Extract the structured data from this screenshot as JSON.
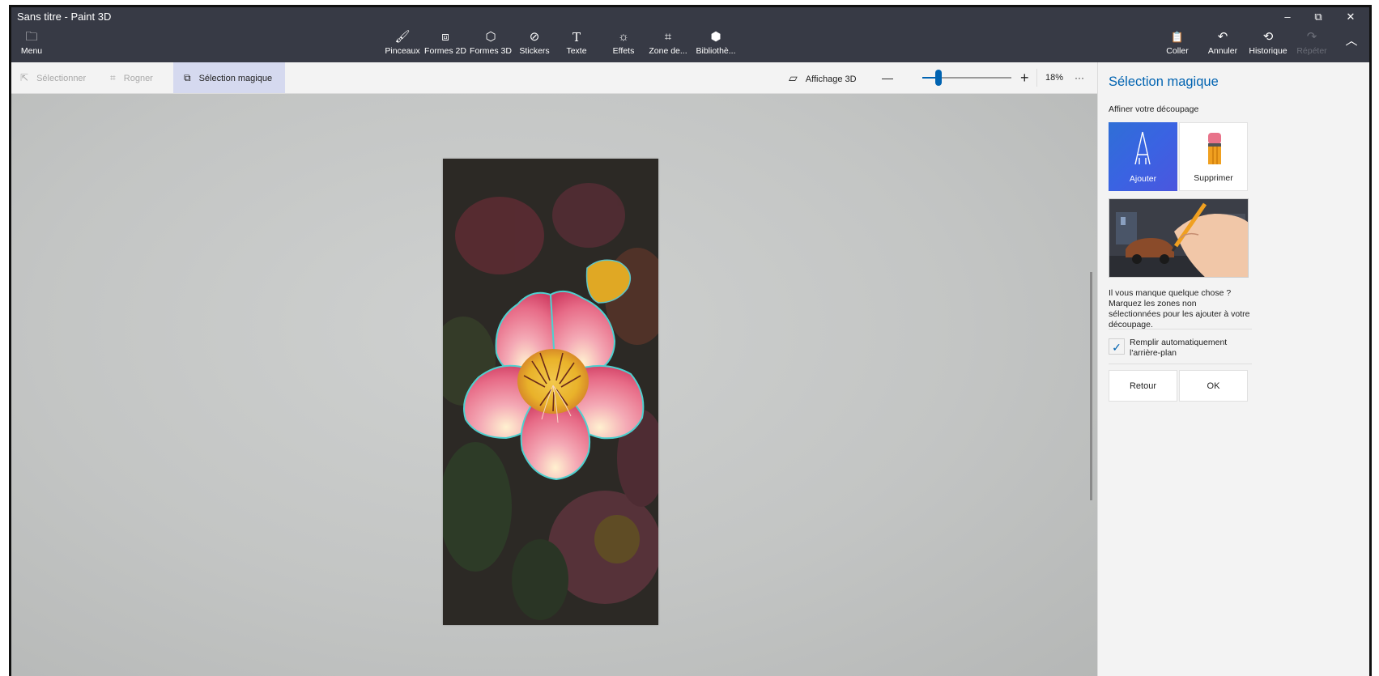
{
  "window": {
    "title": "Sans titre - Paint 3D",
    "minimize": "–",
    "restore": "⧉",
    "close": "✕"
  },
  "ribbon": {
    "menu": {
      "icon": "folder-icon",
      "glyph": "🗀",
      "label": "Menu"
    },
    "tools": [
      {
        "key": "pinceaux",
        "icon": "brush-icon",
        "glyph": "🖌",
        "label": "Pinceaux"
      },
      {
        "key": "formes2d",
        "icon": "shapes-2d-icon",
        "glyph": "⧈",
        "label": "Formes 2D"
      },
      {
        "key": "formes3d",
        "icon": "cube-icon",
        "glyph": "⬡",
        "label": "Formes 3D"
      },
      {
        "key": "stickers",
        "icon": "sticker-icon",
        "glyph": "⊘",
        "label": "Stickers"
      },
      {
        "key": "texte",
        "icon": "text-icon",
        "glyph": "T",
        "label": "Texte"
      },
      {
        "key": "effets",
        "icon": "sun-icon",
        "glyph": "☼",
        "label": "Effets"
      },
      {
        "key": "zone",
        "icon": "canvas-icon",
        "glyph": "⌗",
        "label": "Zone de..."
      },
      {
        "key": "biblio",
        "icon": "library-icon",
        "glyph": "⬢",
        "label": "Bibliothè..."
      }
    ],
    "right": [
      {
        "key": "coller",
        "icon": "paste-icon",
        "glyph": "📋",
        "label": "Coller",
        "enabled": true
      },
      {
        "key": "annuler",
        "icon": "undo-icon",
        "glyph": "↶",
        "label": "Annuler",
        "enabled": true
      },
      {
        "key": "historique",
        "icon": "history-icon",
        "glyph": "⟲",
        "label": "Historique",
        "enabled": true
      },
      {
        "key": "repeter",
        "icon": "redo-icon",
        "glyph": "↷",
        "label": "Répéter",
        "enabled": false
      }
    ],
    "collapse_glyph": "︿"
  },
  "subbar": {
    "select": "Sélectionner",
    "crop": "Rogner",
    "magic": "Sélection magique",
    "view3d": "Affichage 3D",
    "zoom_minus": "—",
    "zoom_plus": "+",
    "zoom_level": 18,
    "zoom_text": "18%",
    "more": "···"
  },
  "panel": {
    "title": "Sélection magique",
    "subtitle": "Affiner votre découpage",
    "add_label": "Ajouter",
    "delete_label": "Supprimer",
    "help_text": "Il vous manque quelque chose ? Marquez les zones non sélectionnées pour les ajouter à votre découpage.",
    "autofill_checked": true,
    "autofill_label": "Remplir automatiquement l'arrière-plan",
    "back_label": "Retour",
    "ok_label": "OK"
  },
  "colors": {
    "accent": "#0063b1",
    "ribbon": "#373a45",
    "active_tool": "#d5d9ef"
  }
}
